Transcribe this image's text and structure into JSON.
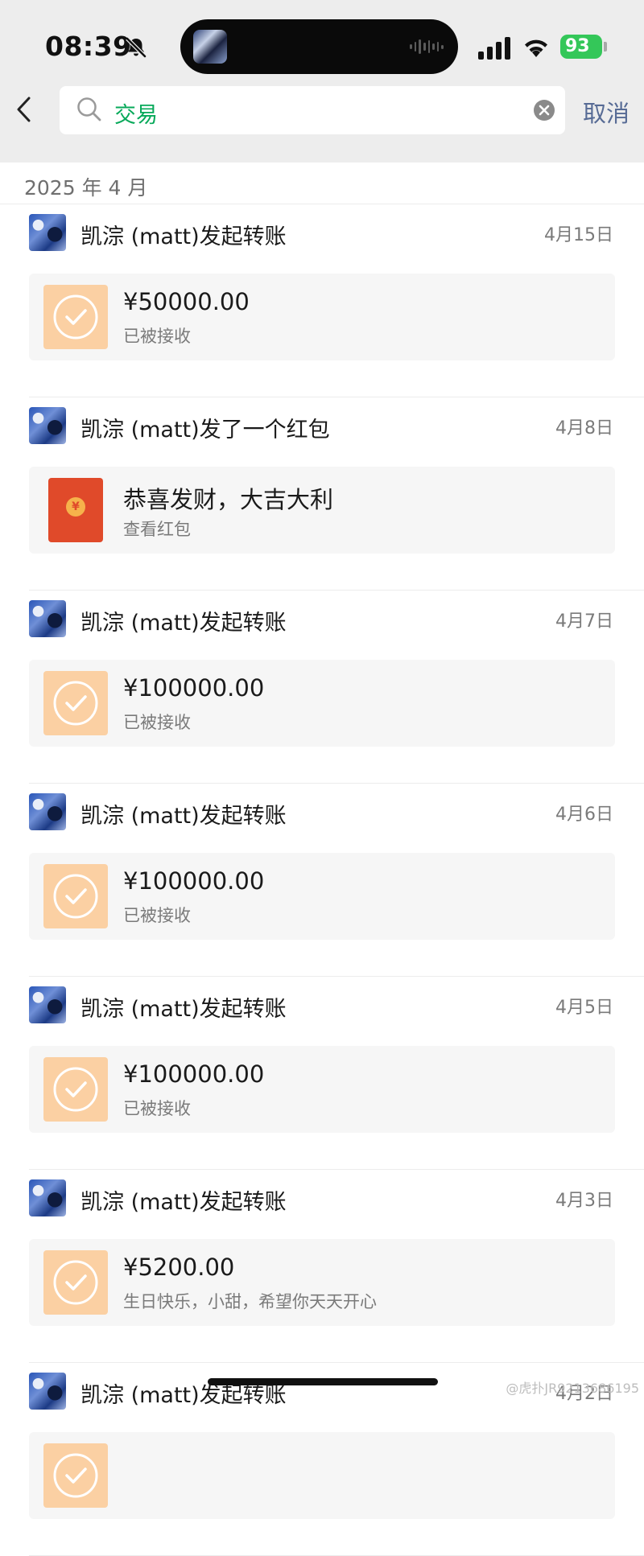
{
  "status_bar": {
    "time": "08:39",
    "battery": "93",
    "icons": [
      "bell-off-icon",
      "cellular-signal-icon",
      "wifi-icon",
      "battery-charging-icon"
    ]
  },
  "search": {
    "query": "交易",
    "cancel_label": "取消"
  },
  "month": "2025 年 4 月",
  "records": [
    {
      "sender": "凯淙 (matt)发起转账",
      "date": "4月15日",
      "type": "transfer",
      "title": "¥50000.00",
      "subtitle": "已被接收"
    },
    {
      "sender": "凯淙 (matt)发了一个红包",
      "date": "4月8日",
      "type": "red_packet",
      "title": "恭喜发财，大吉大利",
      "subtitle": "查看红包"
    },
    {
      "sender": "凯淙 (matt)发起转账",
      "date": "4月7日",
      "type": "transfer",
      "title": "¥100000.00",
      "subtitle": "已被接收"
    },
    {
      "sender": "凯淙 (matt)发起转账",
      "date": "4月6日",
      "type": "transfer",
      "title": "¥100000.00",
      "subtitle": "已被接收"
    },
    {
      "sender": "凯淙 (matt)发起转账",
      "date": "4月5日",
      "type": "transfer",
      "title": "¥100000.00",
      "subtitle": "已被接收"
    },
    {
      "sender": "凯淙 (matt)发起转账",
      "date": "4月3日",
      "type": "transfer",
      "title": "¥5200.00",
      "subtitle": "生日快乐，小甜，希望你天天开心"
    },
    {
      "sender": "凯淙 (matt)发起转账",
      "date": "4月2日",
      "type": "transfer",
      "title": "",
      "subtitle": ""
    }
  ],
  "watermark": "@虎扑JR9213686195",
  "colors": {
    "accent_green": "#07a95a",
    "link_blue": "#576b95",
    "transfer_icon_bg": "#fbd0a3",
    "red_packet": "#e04a2a"
  }
}
